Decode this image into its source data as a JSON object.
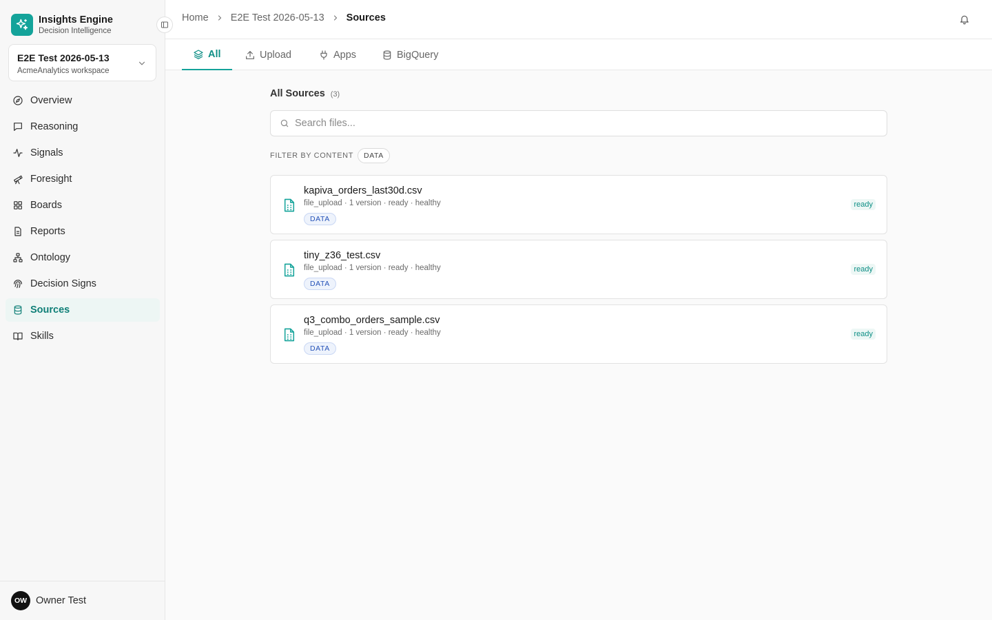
{
  "brand": {
    "name": "Insights Engine",
    "subtitle": "Decision Intelligence"
  },
  "workspace": {
    "name": "E2E Test 2026-05-13",
    "subtitle": "AcmeAnalytics workspace"
  },
  "nav": {
    "items": [
      {
        "label": "Overview",
        "icon": "compass-icon"
      },
      {
        "label": "Reasoning",
        "icon": "message-square-icon"
      },
      {
        "label": "Signals",
        "icon": "activity-icon"
      },
      {
        "label": "Foresight",
        "icon": "telescope-icon"
      },
      {
        "label": "Boards",
        "icon": "grid-icon"
      },
      {
        "label": "Reports",
        "icon": "file-text-icon"
      },
      {
        "label": "Ontology",
        "icon": "network-icon"
      },
      {
        "label": "Decision Signs",
        "icon": "fingerprint-icon"
      },
      {
        "label": "Sources",
        "icon": "database-icon",
        "active": true
      },
      {
        "label": "Skills",
        "icon": "book-open-icon"
      }
    ]
  },
  "user": {
    "initials": "OW",
    "name": "Owner Test"
  },
  "breadcrumb": {
    "home": "Home",
    "project": "E2E Test 2026-05-13",
    "current": "Sources"
  },
  "tabs": [
    {
      "label": "All",
      "icon": "layers-icon",
      "active": true
    },
    {
      "label": "Upload",
      "icon": "upload-icon"
    },
    {
      "label": "Apps",
      "icon": "plug-icon"
    },
    {
      "label": "BigQuery",
      "icon": "database-icon"
    }
  ],
  "sources": {
    "title": "All Sources",
    "count": "(3)",
    "search_placeholder": "Search files...",
    "filter_label": "FILTER BY CONTENT",
    "filter_chip": "DATA",
    "items": [
      {
        "name": "kapiva_orders_last30d.csv",
        "meta": "file_upload · 1 version · ready · healthy",
        "tag": "DATA",
        "status": "ready"
      },
      {
        "name": "tiny_z36_test.csv",
        "meta": "file_upload · 1 version · ready · healthy",
        "tag": "DATA",
        "status": "ready"
      },
      {
        "name": "q3_combo_orders_sample.csv",
        "meta": "file_upload · 1 version · ready · healthy",
        "tag": "DATA",
        "status": "ready"
      }
    ]
  },
  "colors": {
    "accent": "#14a39a",
    "accent_text": "#0f8f86",
    "tag_blue": "#2552b8"
  }
}
